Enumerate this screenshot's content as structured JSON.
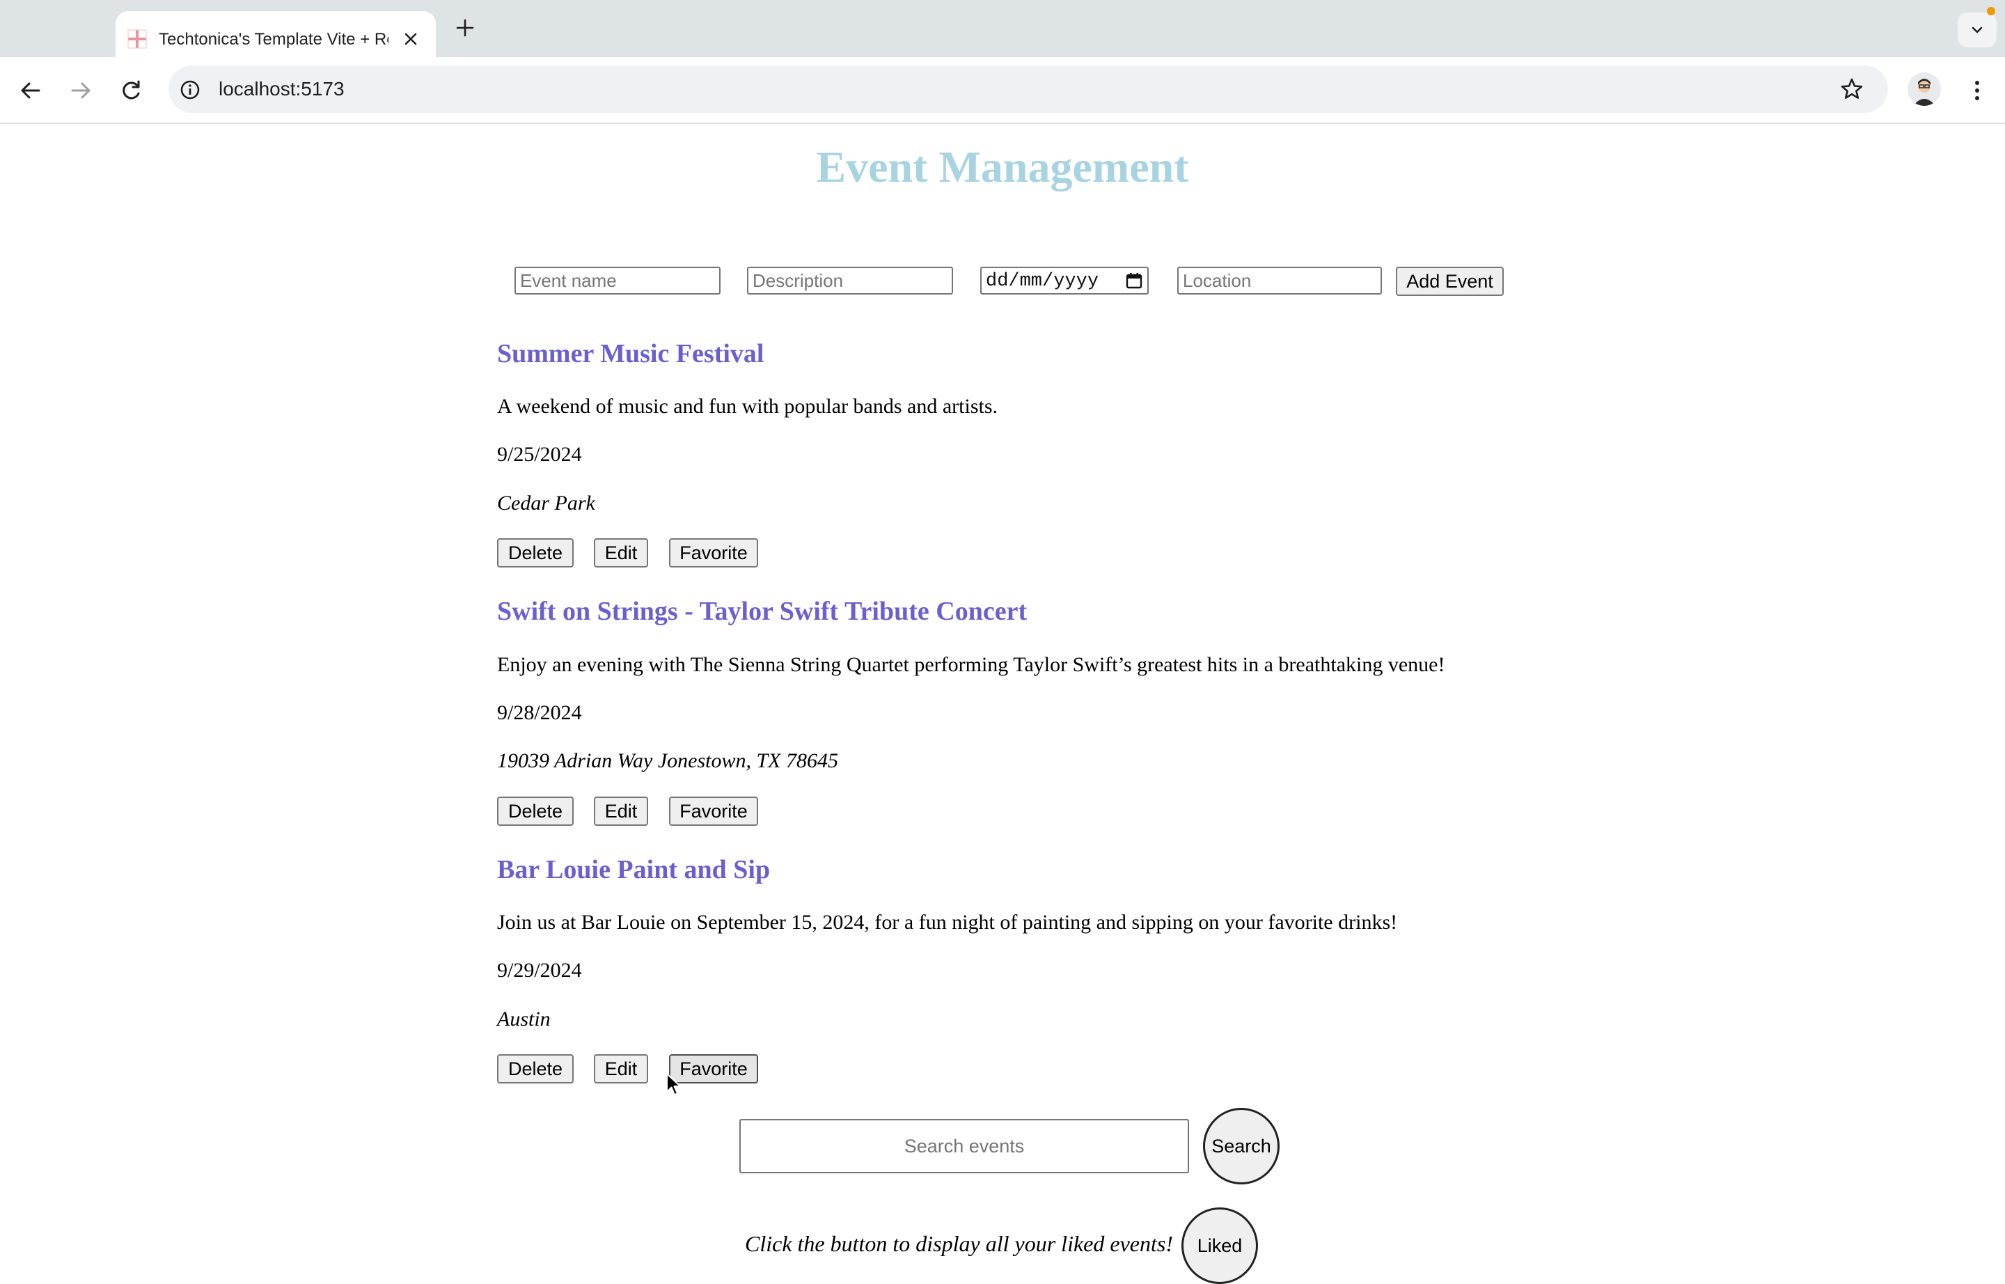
{
  "browser": {
    "tab_title": "Techtonica's Template Vite + React",
    "url": "localhost:5173"
  },
  "page": {
    "title": "Event Management"
  },
  "form": {
    "name_placeholder": "Event name",
    "description_placeholder": "Description",
    "date_placeholder": "dd/mm/yyyy",
    "location_placeholder": "Location",
    "add_button": "Add Event"
  },
  "events": [
    {
      "title": "Summer Music Festival",
      "description": "A weekend of music and fun with popular bands and artists.",
      "date": "9/25/2024",
      "location": "Cedar Park"
    },
    {
      "title": "Swift on Strings - Taylor Swift Tribute Concert",
      "description": "Enjoy an evening with The Sienna String Quartet performing Taylor Swift’s greatest hits in a breathtaking venue!",
      "date": "9/28/2024",
      "location": "19039 Adrian Way Jonestown, TX 78645"
    },
    {
      "title": "Bar Louie Paint and Sip",
      "description": "Join us at Bar Louie on September 15, 2024, for a fun night of painting and sipping on your favorite drinks!",
      "date": "9/29/2024",
      "location": "Austin"
    }
  ],
  "event_actions": {
    "delete": "Delete",
    "edit": "Edit",
    "favorite": "Favorite"
  },
  "search": {
    "placeholder": "Search events",
    "button": "Search"
  },
  "liked": {
    "caption": "Click the button to display all your liked events!",
    "button": "Liked"
  },
  "colors": {
    "page_title": "#a8d3e0",
    "event_title": "#6b5fcf"
  }
}
